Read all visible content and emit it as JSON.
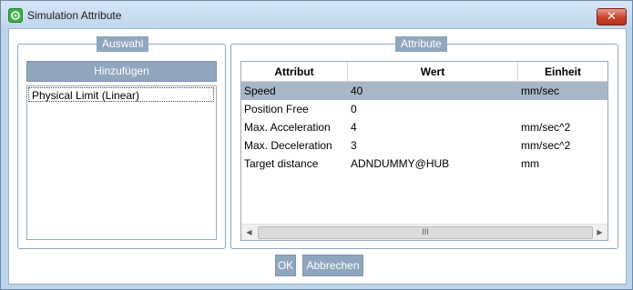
{
  "window": {
    "title": "Simulation Attribute",
    "close_glyph": "✕"
  },
  "auswahl": {
    "caption": "Auswahl",
    "add_button": "Hinzufügen",
    "items": [
      "Physical Limit (Linear)"
    ]
  },
  "attribute": {
    "caption": "Attribute",
    "columns": [
      "Attribut",
      "Wert",
      "Einheit"
    ],
    "rows": [
      {
        "attribut": "Speed",
        "wert": "40",
        "einheit": "mm/sec",
        "selected": true
      },
      {
        "attribut": "Position Free",
        "wert": "0",
        "einheit": ""
      },
      {
        "attribut": "Max. Acceleration",
        "wert": "4",
        "einheit": "mm/sec^2"
      },
      {
        "attribut": "Max. Deceleration",
        "wert": "3",
        "einheit": "mm/sec^2"
      },
      {
        "attribut": "Target distance",
        "wert": "ADNDUMMY@HUB",
        "einheit": "mm"
      }
    ],
    "scroll_thumb_grip": "III"
  },
  "footer": {
    "ok": "OK",
    "cancel": "Abbrechen"
  },
  "colors": {
    "frame": "#bcd5ec",
    "accent": "#8fa6bd",
    "selection": "#a7b7c7",
    "close_red": "#c9442f"
  }
}
